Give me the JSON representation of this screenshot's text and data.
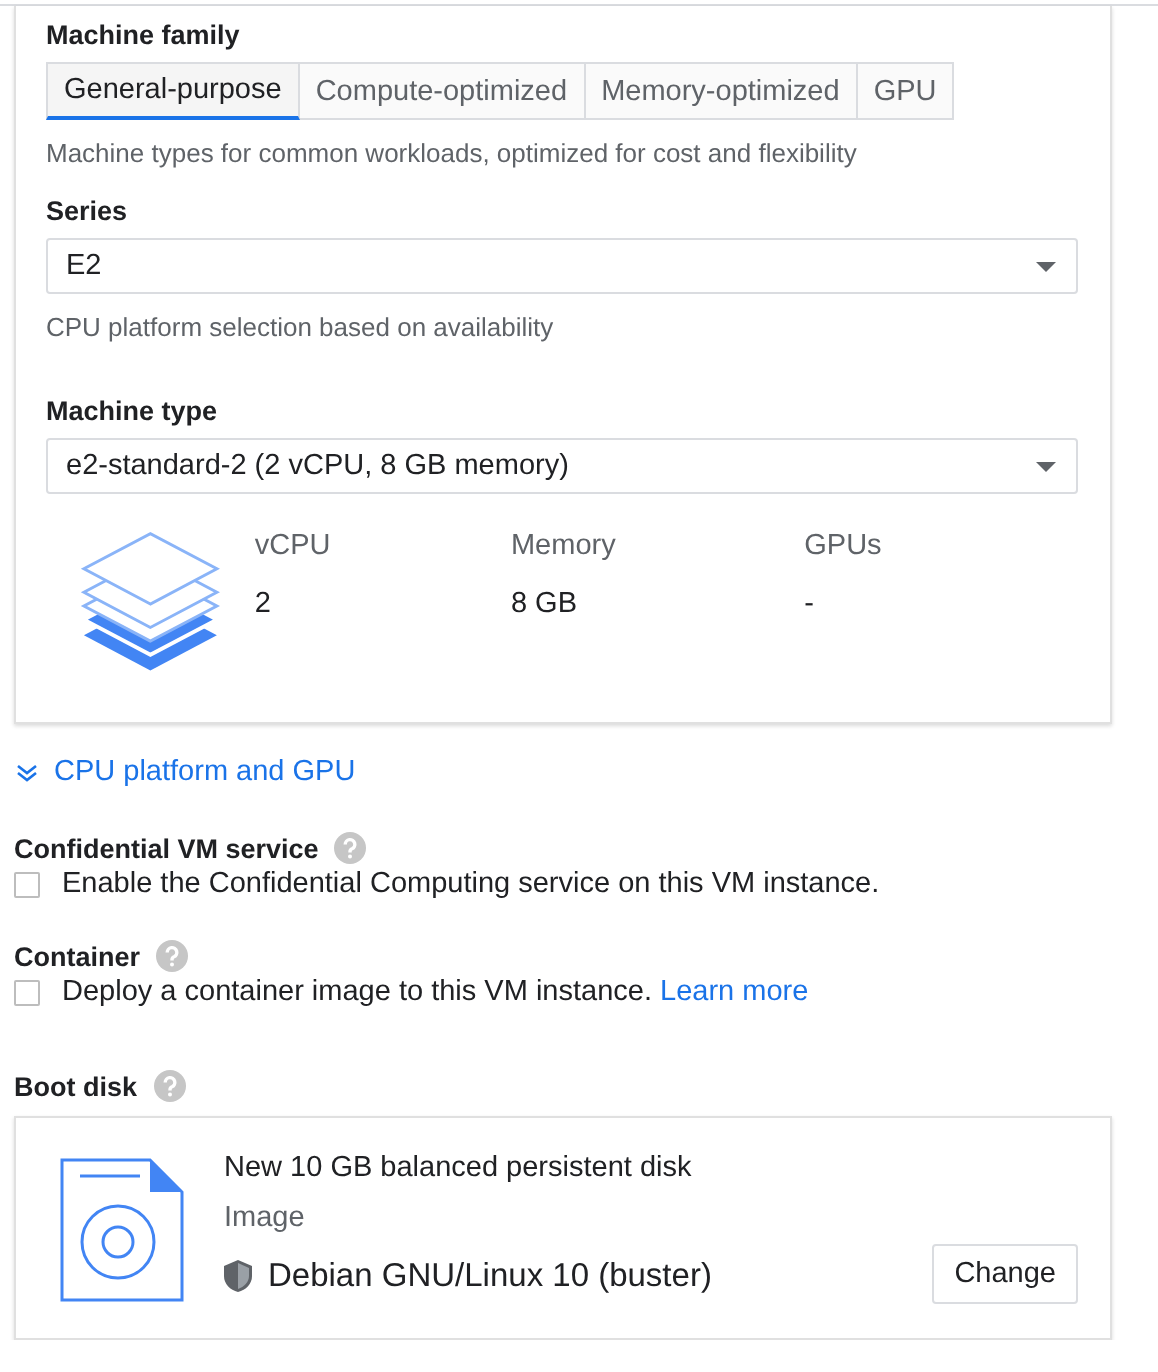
{
  "machine_family": {
    "label": "Machine family",
    "tabs": [
      {
        "label": "General-purpose",
        "selected": true
      },
      {
        "label": "Compute-optimized",
        "selected": false
      },
      {
        "label": "Memory-optimized",
        "selected": false
      },
      {
        "label": "GPU",
        "selected": false
      }
    ],
    "description": "Machine types for common workloads, optimized for cost and flexibility"
  },
  "series": {
    "label": "Series",
    "value": "E2",
    "description": "CPU platform selection based on availability"
  },
  "machine_type": {
    "label": "Machine type",
    "value": "e2-standard-2 (2 vCPU, 8 GB memory)",
    "specs": [
      {
        "label": "vCPU",
        "value": "2"
      },
      {
        "label": "Memory",
        "value": "8 GB"
      },
      {
        "label": "GPUs",
        "value": "-"
      }
    ]
  },
  "expander": {
    "label": "CPU platform and GPU",
    "expanded": false
  },
  "confidential_vm": {
    "label": "Confidential VM service",
    "checkbox": {
      "label": "Enable the Confidential Computing service on this VM instance.",
      "checked": false
    }
  },
  "container": {
    "label": "Container",
    "checkbox": {
      "label": "Deploy a container image to this VM instance.",
      "checked": false,
      "link": "Learn more"
    }
  },
  "boot_disk": {
    "label": "Boot disk",
    "title": "New 10 GB balanced persistent disk",
    "image_label": "Image",
    "image": "Debian GNU/Linux 10 (buster)",
    "button": "Change"
  }
}
